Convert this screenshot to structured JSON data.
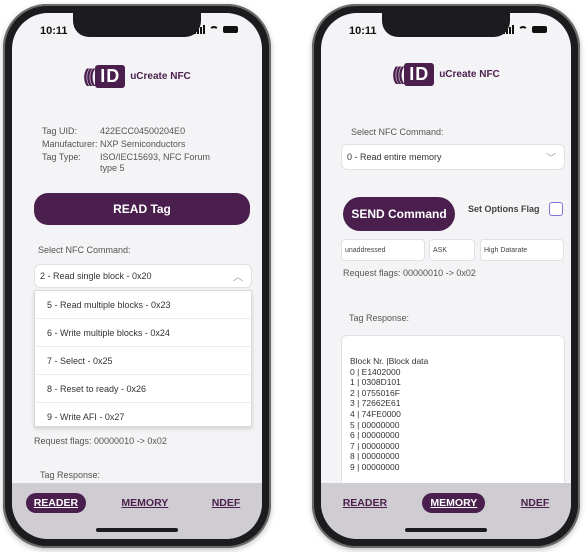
{
  "left": {
    "status_time": "10:11",
    "logo_text": "uCreate NFC",
    "tag_info": [
      {
        "key": "Tag UID:",
        "value": "422ECC04500204E0"
      },
      {
        "key": "Manufacturer:",
        "value": "NXP Semiconductors"
      },
      {
        "key": "Tag Type:",
        "value": "ISO/IEC15693, NFC Forum type 5"
      }
    ],
    "read_button": "READ Tag",
    "select_label": "Select NFC Command:",
    "selected_command": "2 - Read single block - 0x20",
    "dropdown_options": [
      "5 - Read multiple blocks - 0x23",
      "6 - Write multiple blocks - 0x24",
      "7 - Select - 0x25",
      "8 - Reset to ready - 0x26",
      "9 - Write AFI - 0x27"
    ],
    "request_flags": "Request flags: 00000010 -> 0x02",
    "tag_response_label": "Tag Response:",
    "tabs": [
      "READER",
      "MEMORY",
      "NDEF"
    ],
    "active_tab": "READER"
  },
  "right": {
    "status_time": "10:11",
    "logo_text": "uCreate NFC",
    "select_label": "Select NFC Command:",
    "selected_command": "0 - Read entire memory",
    "send_button": "SEND Command",
    "options_flag_label": "Set Options Flag",
    "fields": [
      "unaddressed",
      "ASK",
      "High Datarate"
    ],
    "request_flags": "Request flags: 00000010 -> 0x02",
    "tag_response_label": "Tag Response:",
    "response_header": "Block Nr. |Block data",
    "response_lines": [
      "0 | E1402000",
      "1 | 0308D101",
      "2 | 0755016F",
      "3 | 72662E61",
      "4 | 74FE0000",
      "5 | 00000000",
      "6 | 00000000",
      "7 | 00000000",
      "8 | 00000000",
      "9 | 00000000"
    ],
    "tabs": [
      "READER",
      "MEMORY",
      "NDEF"
    ],
    "active_tab": "MEMORY"
  },
  "colors": {
    "brand": "#4a1f4e",
    "tabbar": "#cfcdd1",
    "screen_bg": "#f4f3f5",
    "checkbox_border": "#8a6fd6"
  },
  "icons": [
    "signal-icon",
    "wifi-icon",
    "battery-icon",
    "nfc-waves-icon",
    "chevron-up-icon",
    "chevron-down-icon"
  ]
}
